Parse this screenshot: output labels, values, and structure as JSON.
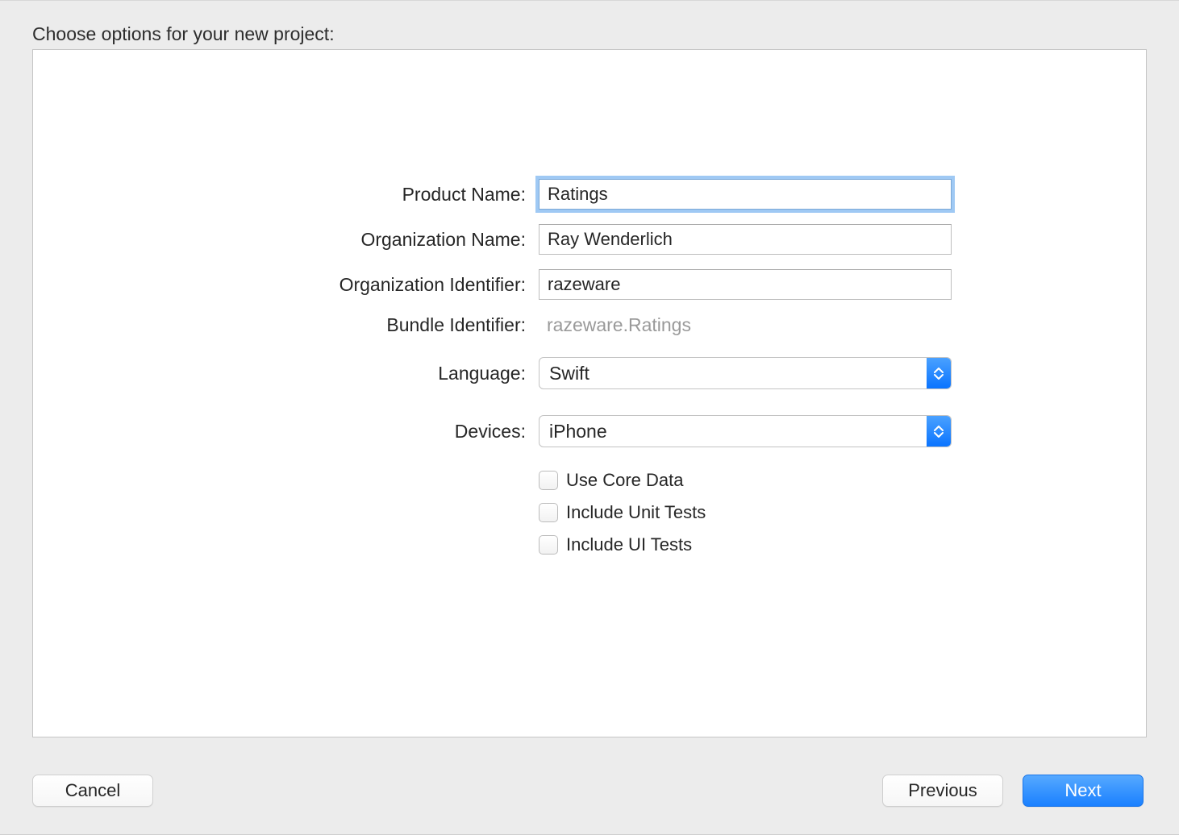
{
  "title": "Choose options for your new project:",
  "form": {
    "product_name_label": "Product Name:",
    "product_name_value": "Ratings",
    "organization_name_label": "Organization Name:",
    "organization_name_value": "Ray Wenderlich",
    "organization_identifier_label": "Organization Identifier:",
    "organization_identifier_value": "razeware",
    "bundle_identifier_label": "Bundle Identifier:",
    "bundle_identifier_value": "razeware.Ratings",
    "language_label": "Language:",
    "language_value": "Swift",
    "devices_label": "Devices:",
    "devices_value": "iPhone",
    "use_core_data_label": "Use Core Data",
    "include_unit_tests_label": "Include Unit Tests",
    "include_ui_tests_label": "Include UI Tests"
  },
  "buttons": {
    "cancel": "Cancel",
    "previous": "Previous",
    "next": "Next"
  }
}
